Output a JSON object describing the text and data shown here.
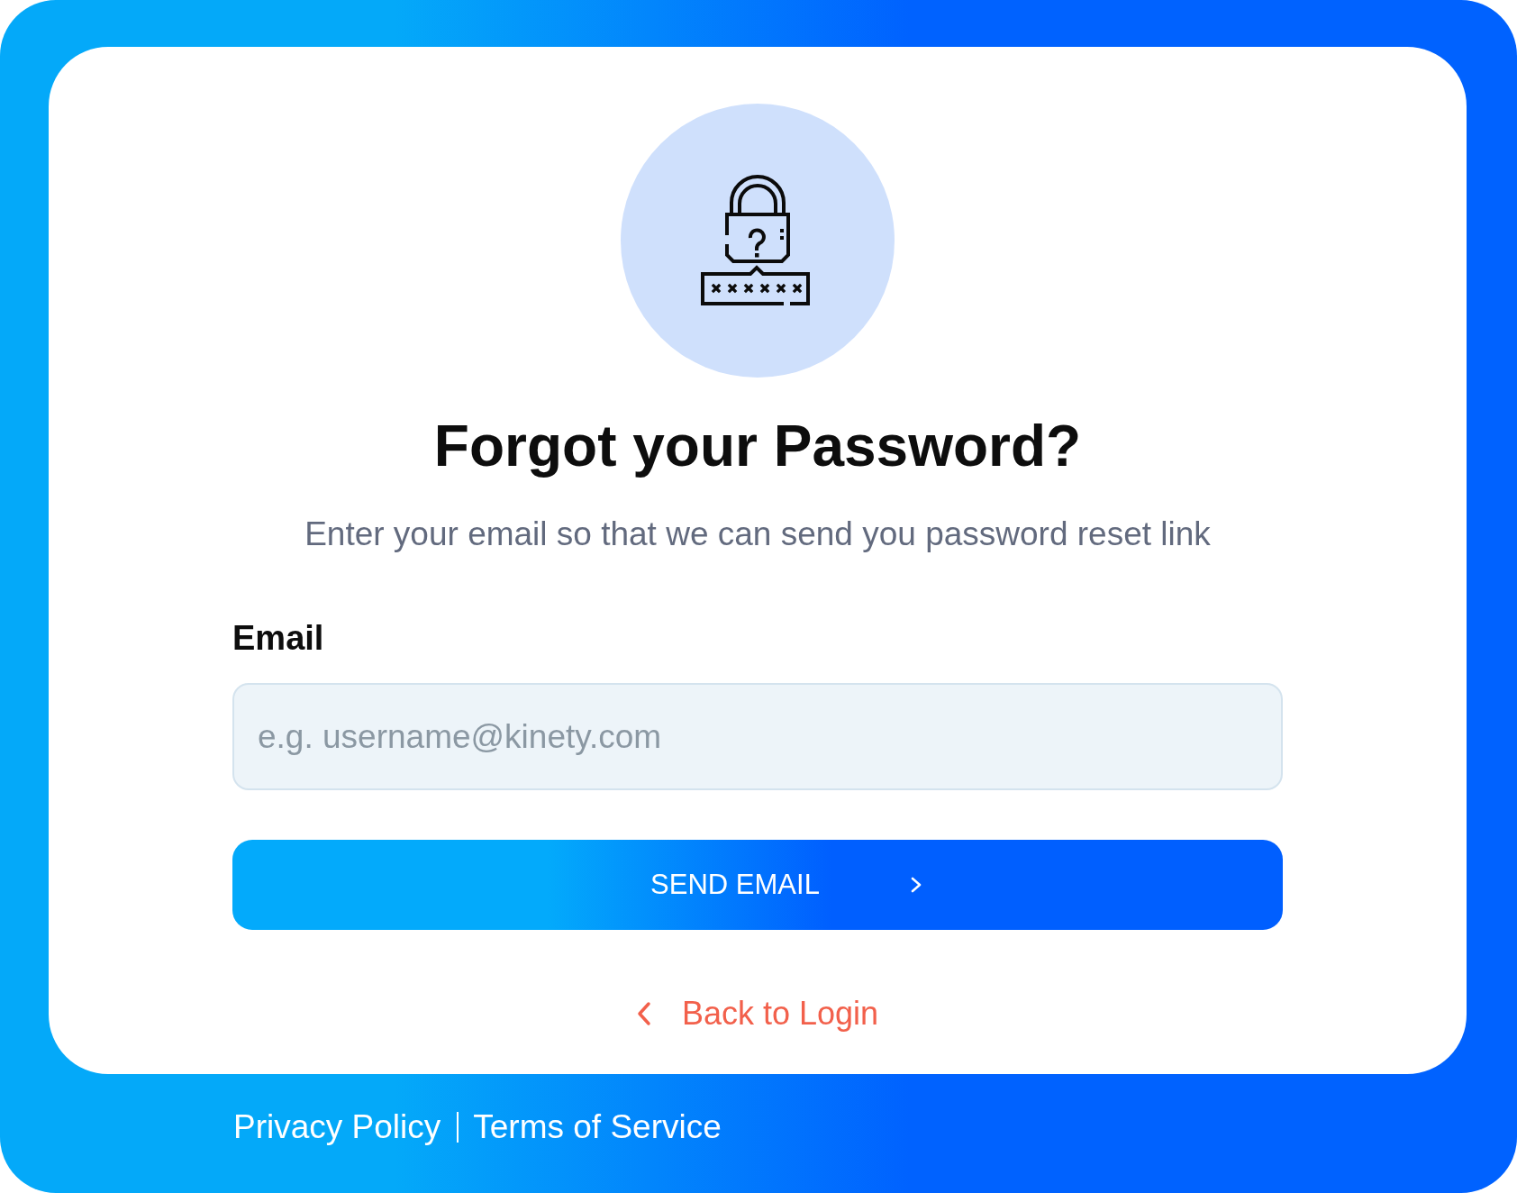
{
  "heading": "Forgot your Password?",
  "subtitle": "Enter your email so that we can send you password reset link",
  "form": {
    "fields": [
      {
        "label": "Email",
        "placeholder": "e.g. username@kinety.com"
      }
    ],
    "submit": {
      "label": "SEND EMAIL"
    }
  },
  "back_link": {
    "label": "Back to Login"
  },
  "footer": {
    "links": [
      "Privacy Policy",
      "Terms of Service"
    ]
  }
}
